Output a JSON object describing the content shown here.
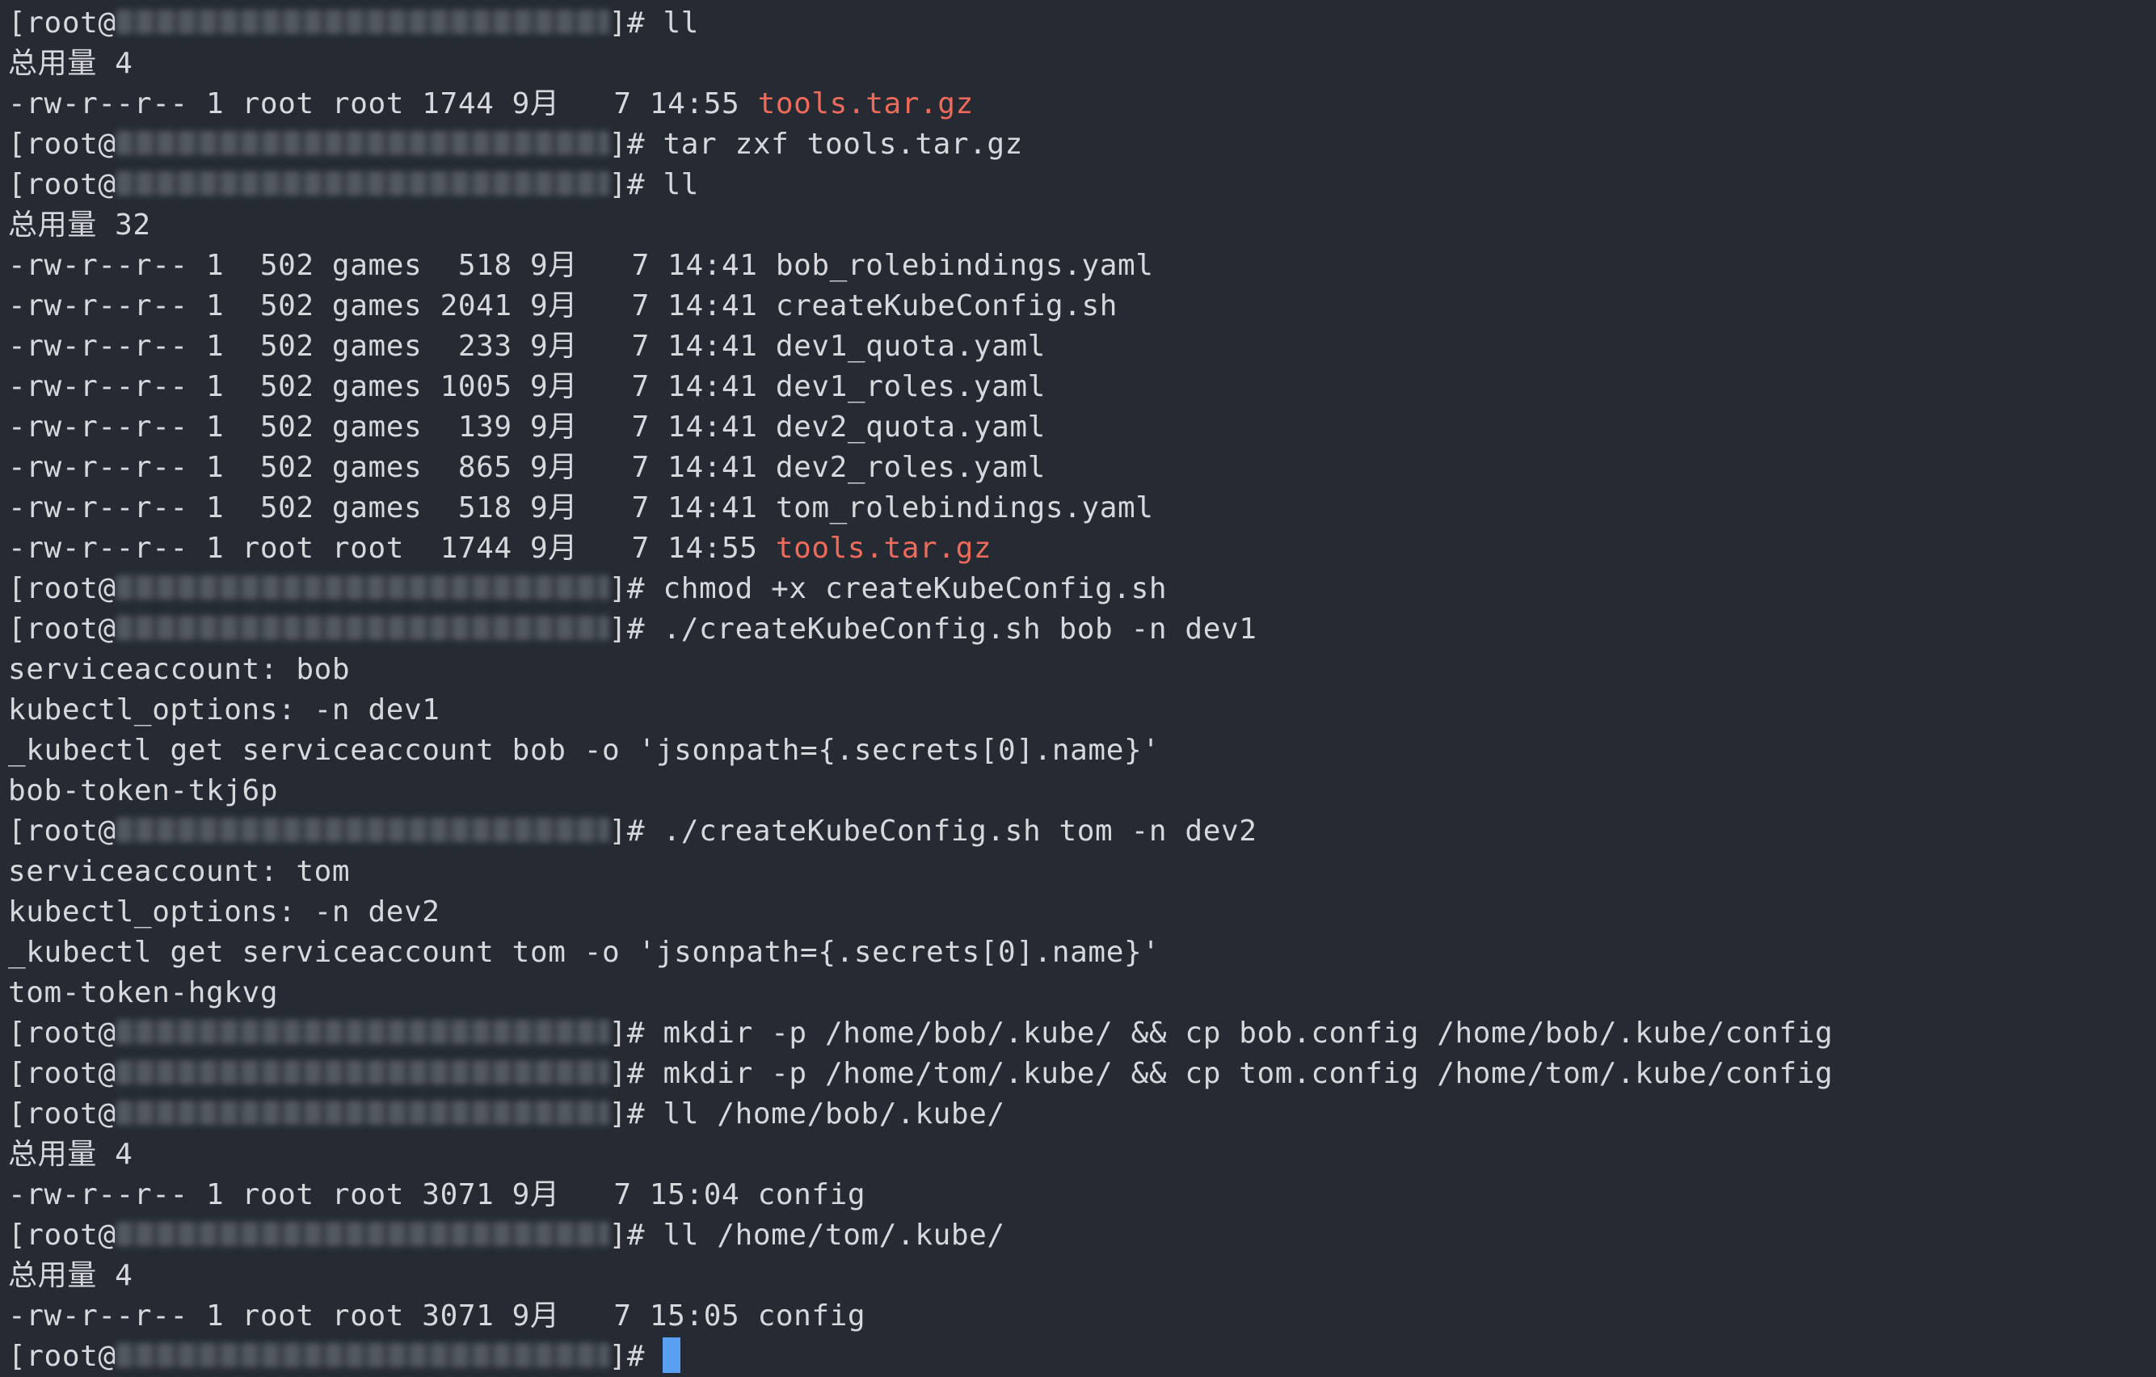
{
  "terminal": {
    "colors": {
      "background": "#262b33",
      "foreground": "#d6d8dc",
      "archive": "#ef6a5a",
      "cursor": "#5aa0f0"
    },
    "prompt_open": "[root@",
    "prompt_close": "]# ",
    "lines": [
      {
        "type": "prompt",
        "cmd": "ll"
      },
      {
        "type": "text",
        "text": "总用量 4"
      },
      {
        "type": "ls",
        "prefix": "-rw-r--r-- 1 root root 1744 9月   7 14:55 ",
        "name": "tools.tar.gz",
        "archive": true
      },
      {
        "type": "prompt",
        "cmd": "tar zxf tools.tar.gz"
      },
      {
        "type": "prompt",
        "cmd": "ll"
      },
      {
        "type": "text",
        "text": "总用量 32"
      },
      {
        "type": "ls",
        "prefix": "-rw-r--r-- 1  502 games  518 9月   7 14:41 ",
        "name": "bob_rolebindings.yaml",
        "archive": false
      },
      {
        "type": "ls",
        "prefix": "-rw-r--r-- 1  502 games 2041 9月   7 14:41 ",
        "name": "createKubeConfig.sh",
        "archive": false
      },
      {
        "type": "ls",
        "prefix": "-rw-r--r-- 1  502 games  233 9月   7 14:41 ",
        "name": "dev1_quota.yaml",
        "archive": false
      },
      {
        "type": "ls",
        "prefix": "-rw-r--r-- 1  502 games 1005 9月   7 14:41 ",
        "name": "dev1_roles.yaml",
        "archive": false
      },
      {
        "type": "ls",
        "prefix": "-rw-r--r-- 1  502 games  139 9月   7 14:41 ",
        "name": "dev2_quota.yaml",
        "archive": false
      },
      {
        "type": "ls",
        "prefix": "-rw-r--r-- 1  502 games  865 9月   7 14:41 ",
        "name": "dev2_roles.yaml",
        "archive": false
      },
      {
        "type": "ls",
        "prefix": "-rw-r--r-- 1  502 games  518 9月   7 14:41 ",
        "name": "tom_rolebindings.yaml",
        "archive": false
      },
      {
        "type": "ls",
        "prefix": "-rw-r--r-- 1 root root  1744 9月   7 14:55 ",
        "name": "tools.tar.gz",
        "archive": true
      },
      {
        "type": "prompt",
        "cmd": "chmod +x createKubeConfig.sh"
      },
      {
        "type": "prompt",
        "cmd": "./createKubeConfig.sh bob -n dev1"
      },
      {
        "type": "text",
        "text": "serviceaccount: bob"
      },
      {
        "type": "text",
        "text": "kubectl_options: -n dev1"
      },
      {
        "type": "text",
        "text": "_kubectl get serviceaccount bob -o 'jsonpath={.secrets[0].name}'"
      },
      {
        "type": "text",
        "text": "bob-token-tkj6p"
      },
      {
        "type": "prompt",
        "cmd": "./createKubeConfig.sh tom -n dev2"
      },
      {
        "type": "text",
        "text": "serviceaccount: tom"
      },
      {
        "type": "text",
        "text": "kubectl_options: -n dev2"
      },
      {
        "type": "text",
        "text": "_kubectl get serviceaccount tom -o 'jsonpath={.secrets[0].name}'"
      },
      {
        "type": "text",
        "text": "tom-token-hgkvg"
      },
      {
        "type": "prompt",
        "cmd": "mkdir -p /home/bob/.kube/ && cp bob.config /home/bob/.kube/config"
      },
      {
        "type": "prompt",
        "cmd": "mkdir -p /home/tom/.kube/ && cp tom.config /home/tom/.kube/config"
      },
      {
        "type": "prompt",
        "cmd": "ll /home/bob/.kube/"
      },
      {
        "type": "text",
        "text": "总用量 4"
      },
      {
        "type": "ls",
        "prefix": "-rw-r--r-- 1 root root 3071 9月   7 15:04 ",
        "name": "config",
        "archive": false
      },
      {
        "type": "prompt",
        "cmd": "ll /home/tom/.kube/"
      },
      {
        "type": "text",
        "text": "总用量 4"
      },
      {
        "type": "ls",
        "prefix": "-rw-r--r-- 1 root root 3071 9月   7 15:05 ",
        "name": "config",
        "archive": false
      },
      {
        "type": "prompt",
        "cmd": "",
        "cursor": true
      }
    ]
  }
}
